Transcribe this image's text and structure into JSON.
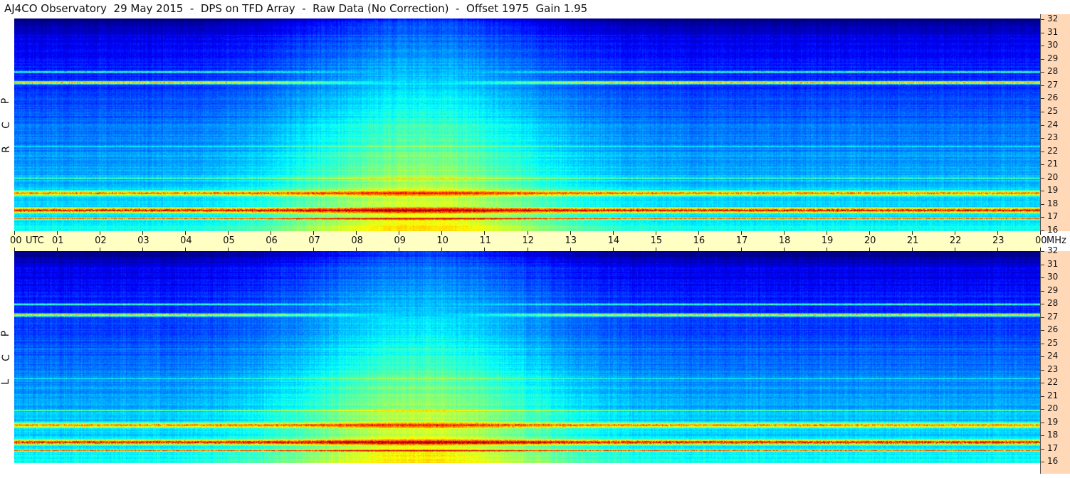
{
  "title": "AJ4CO Observatory  29 May 2015  -  DPS on TFD Array  -  Raw Data (No Correction)  -  Offset 1975  Gain 1.95",
  "panels": [
    {
      "polarization_letters": [
        "R",
        "C",
        "P"
      ]
    },
    {
      "polarization_letters": [
        "L",
        "C",
        "P"
      ]
    }
  ],
  "time_axis": {
    "labels": [
      "00",
      "01",
      "02",
      "03",
      "04",
      "05",
      "06",
      "07",
      "08",
      "09",
      "10",
      "11",
      "12",
      "13",
      "14",
      "15",
      "16",
      "17",
      "18",
      "19",
      "20",
      "21",
      "22",
      "23",
      "00"
    ],
    "unit_left": "UTC",
    "unit_right": "MHz"
  },
  "freq_axis": {
    "labels": [
      "32",
      "31",
      "30",
      "29",
      "28",
      "27",
      "26",
      "25",
      "24",
      "23",
      "22",
      "21",
      "20",
      "19",
      "18",
      "17",
      "16"
    ],
    "min": 16,
    "max": 32
  },
  "colors": {
    "background": "#ffffff",
    "time_strip": "#ffffc4",
    "freq_axis": "#ffd8b8",
    "colormap": "jet"
  }
}
